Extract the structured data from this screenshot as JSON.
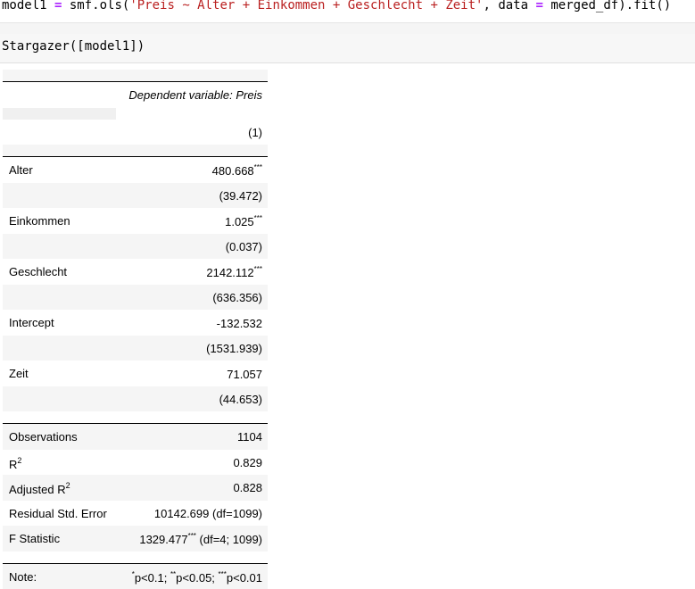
{
  "cell1": {
    "prefix": "model1 ",
    "op1": "=",
    "mid1": " smf.ols(",
    "str": "'Preis ~ Alter + Einkommen + Geschlecht + Zeit'",
    "mid2": ", data ",
    "op2": "=",
    "end": " merged_df).fit()"
  },
  "cell2": {
    "code": "Stargazer([model1])"
  },
  "table": {
    "dep_label": "Dependent variable: Preis",
    "model_col": "(1)",
    "rows": [
      {
        "label": "Alter",
        "coef": "480.668",
        "stars": "***",
        "se": "(39.472)"
      },
      {
        "label": "Einkommen",
        "coef": "1.025",
        "stars": "***",
        "se": "(0.037)"
      },
      {
        "label": "Geschlecht",
        "coef": "2142.112",
        "stars": "***",
        "se": "(636.356)"
      },
      {
        "label": "Intercept",
        "coef": "-132.532",
        "stars": "",
        "se": "(1531.939)"
      },
      {
        "label": "Zeit",
        "coef": "71.057",
        "stars": "",
        "se": "(44.653)"
      }
    ],
    "stats": {
      "obs_label": "Observations",
      "obs": "1104",
      "r2_label": "R",
      "r2_sup": "2",
      "r2": "0.829",
      "adjr2_label": "Adjusted R",
      "adjr2_sup": "2",
      "adjr2": "0.828",
      "rse_label": "Residual Std. Error",
      "rse": "10142.699 (df=1099)",
      "f_label": "F Statistic",
      "f_val": "1329.477",
      "f_stars": "***",
      "f_df": " (df=4; 1099)"
    },
    "note": {
      "label": "Note:",
      "s1": "*",
      "t1": "p<0.1; ",
      "s2": "**",
      "t2": "p<0.05; ",
      "s3": "***",
      "t3": "p<0.01"
    }
  }
}
